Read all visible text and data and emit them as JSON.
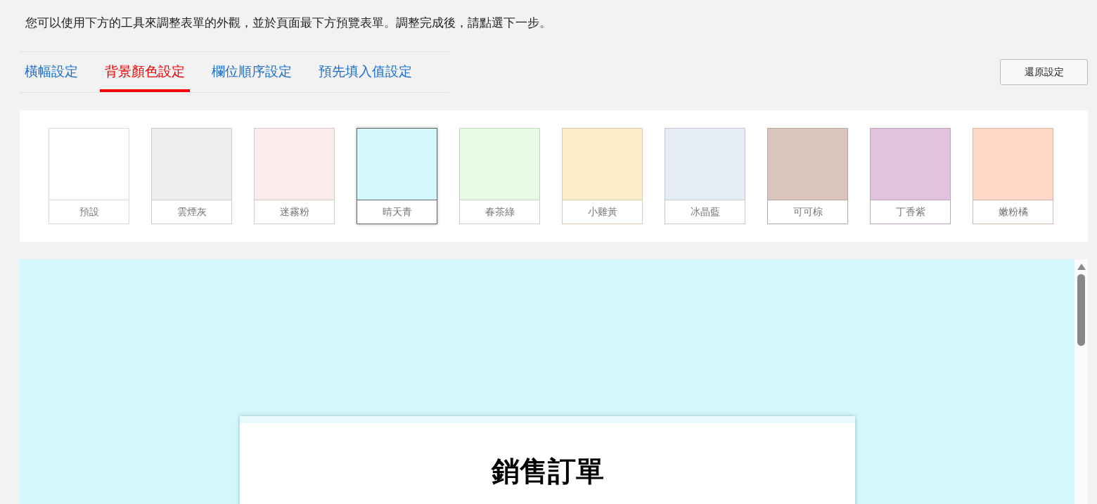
{
  "intro": "您可以使用下方的工具來調整表單的外觀，並於頁面最下方預覽表單。調整完成後，請點選下一步。",
  "tabs": [
    {
      "label": "橫幅設定",
      "selected": false
    },
    {
      "label": "背景顏色設定",
      "selected": true
    },
    {
      "label": "欄位順序設定",
      "selected": false
    },
    {
      "label": "預先填入值設定",
      "selected": false
    }
  ],
  "reset_button": "還原設定",
  "swatches": [
    {
      "label": "預設",
      "color": "#ffffff",
      "selected": false
    },
    {
      "label": "雲煙灰",
      "color": "#efefef",
      "selected": false
    },
    {
      "label": "迷霧粉",
      "color": "#fcebeb",
      "selected": false
    },
    {
      "label": "晴天青",
      "color": "#d2f8fd",
      "selected": true
    },
    {
      "label": "春茶綠",
      "color": "#e6fce2",
      "selected": false
    },
    {
      "label": "小雞黃",
      "color": "#ffefc8",
      "selected": false
    },
    {
      "label": "冰晶藍",
      "color": "#e6edf7",
      "selected": false
    },
    {
      "label": "可可棕",
      "color": "#d9c5bb",
      "selected": false
    },
    {
      "label": "丁香紫",
      "color": "#e2c2de",
      "selected": false
    },
    {
      "label": "嫩粉橘",
      "color": "#fdd8c6",
      "selected": false
    }
  ],
  "preview": {
    "form_title": "銷售訂單"
  }
}
